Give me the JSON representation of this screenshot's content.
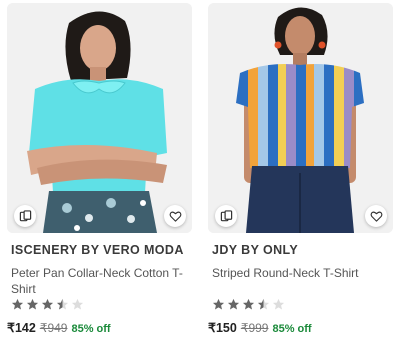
{
  "colors": {
    "accent_green": "#1a8a3a",
    "star_filled": "#666666",
    "star_empty": "#dddddd"
  },
  "products": [
    {
      "brand": "ISCENERY BY VERO MODA",
      "title": "Peter Pan Collar-Neck Cotton T-Shirt",
      "rating": 3.5,
      "max_rating": 5,
      "price": "₹142",
      "mrp": "₹949",
      "discount": "85% off",
      "icons": {
        "compare": "compare-icon",
        "wishlist": "heart-icon"
      }
    },
    {
      "brand": "JDY BY ONLY",
      "title": "Striped Round-Neck T-Shirt",
      "rating": 3.5,
      "max_rating": 5,
      "price": "₹150",
      "mrp": "₹999",
      "discount": "85% off",
      "icons": {
        "compare": "compare-icon",
        "wishlist": "heart-icon"
      }
    }
  ]
}
